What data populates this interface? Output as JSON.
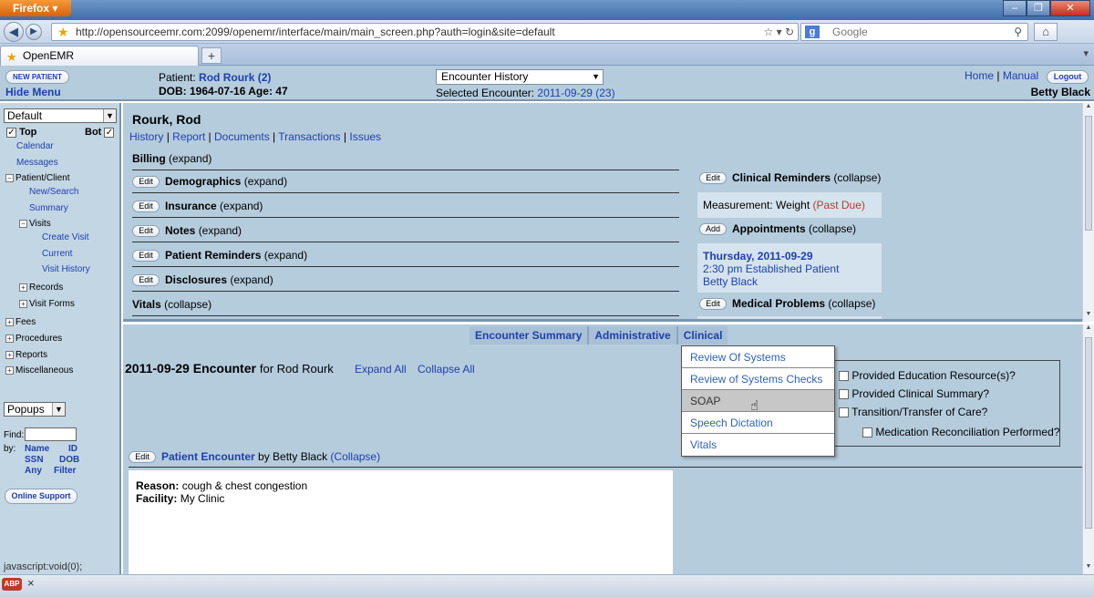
{
  "browser": {
    "app_menu": "Firefox",
    "url": "http://opensourceemr.com:2099/openemr/interface/main/main_screen.php?auth=login&site=default",
    "search_placeholder": "Google",
    "tab_title": "OpenEMR",
    "new_tab": "+"
  },
  "header": {
    "new_patient": "NEW PATIENT",
    "hide_menu": "Hide Menu",
    "patient_label": "Patient:",
    "patient_name": "Rod Rourk (2)",
    "dob_line": "DOB: 1964-07-16 Age: 47",
    "encounter_select": "Encounter History",
    "selected_encounter_label": "Selected Encounter:",
    "selected_encounter": "2011-09-29 (23)",
    "home": "Home",
    "sep": "|",
    "manual": "Manual",
    "logout": "Logout",
    "user": "Betty Black"
  },
  "sidebar": {
    "view_select": "Default",
    "top_label": "Top",
    "bot_label": "Bot",
    "items": [
      {
        "label": "Calendar"
      },
      {
        "label": "Messages"
      },
      {
        "label": "Patient/Client"
      },
      {
        "label": "New/Search"
      },
      {
        "label": "Summary"
      },
      {
        "label": "Visits"
      },
      {
        "label": "Create Visit"
      },
      {
        "label": "Current"
      },
      {
        "label": "Visit History"
      },
      {
        "label": "Records"
      },
      {
        "label": "Visit Forms"
      },
      {
        "label": "Fees"
      },
      {
        "label": "Procedures"
      },
      {
        "label": "Reports"
      },
      {
        "label": "Miscellaneous"
      }
    ],
    "popups_select": "Popups",
    "find_label": "Find:",
    "by_label": "by:",
    "find_by": [
      "Name",
      "ID",
      "SSN",
      "DOB",
      "Any",
      "Filter"
    ],
    "online_support": "Online Support",
    "status_text": "javascript:void(0);"
  },
  "summary": {
    "patient_fullname": "Rourk, Rod",
    "links": [
      "History",
      "Report",
      "Documents",
      "Transactions",
      "Issues"
    ],
    "link_sep": "|",
    "sections": [
      {
        "title": "Billing",
        "state": "(expand)",
        "edit": ""
      },
      {
        "title": "Demographics",
        "state": "(expand)",
        "edit": "Edit"
      },
      {
        "title": "Insurance",
        "state": "(expand)",
        "edit": "Edit"
      },
      {
        "title": "Notes",
        "state": "(expand)",
        "edit": "Edit"
      },
      {
        "title": "Patient Reminders",
        "state": "(expand)",
        "edit": "Edit"
      },
      {
        "title": "Disclosures",
        "state": "(expand)",
        "edit": "Edit"
      },
      {
        "title": "Vitals",
        "state": "(collapse)",
        "edit": ""
      }
    ],
    "right": {
      "clinical_reminders": {
        "btn": "Edit",
        "title": "Clinical Reminders",
        "state": "(collapse)"
      },
      "measurement_label": "Measurement: Weight",
      "measurement_status": "(Past Due)",
      "appointments": {
        "btn": "Add",
        "title": "Appointments",
        "state": "(collapse)"
      },
      "appt_date": "Thursday, 2011-09-29",
      "appt_desc": "2:30 pm Established Patient",
      "appt_provider": "Betty Black",
      "medical_problems": {
        "btn": "Edit",
        "title": "Medical Problems",
        "state": "(collapse)"
      }
    }
  },
  "encounter": {
    "tabs": [
      "Encounter Summary",
      "Administrative",
      "Clinical"
    ],
    "title_date": "2011-09-29 Encounter",
    "title_for": "for Rod Rourk",
    "expand_all": "Expand All",
    "collapse_all": "Collapse All",
    "checks": [
      "Provided Education Resource(s)?",
      "Provided Clinical Summary?",
      "Transition/Transfer of Care?",
      "Medication Reconciliation Performed?"
    ],
    "pe_edit": "Edit",
    "pe_title": "Patient Encounter",
    "pe_by": "by Betty Black",
    "pe_state": "(Collapse)",
    "reason_label": "Reason:",
    "reason_value": "cough & chest congestion",
    "facility_label": "Facility:",
    "facility_value": "My Clinic"
  },
  "clinical_menu": {
    "items": [
      "Review Of Systems",
      "Review of Systems Checks",
      "SOAP",
      "Speech Dictation",
      "Vitals"
    ],
    "hover_index": 2
  },
  "colors": {
    "header_bg": "#b5ccdd",
    "link": "#1f3fae",
    "past_due": "#c0392b"
  }
}
